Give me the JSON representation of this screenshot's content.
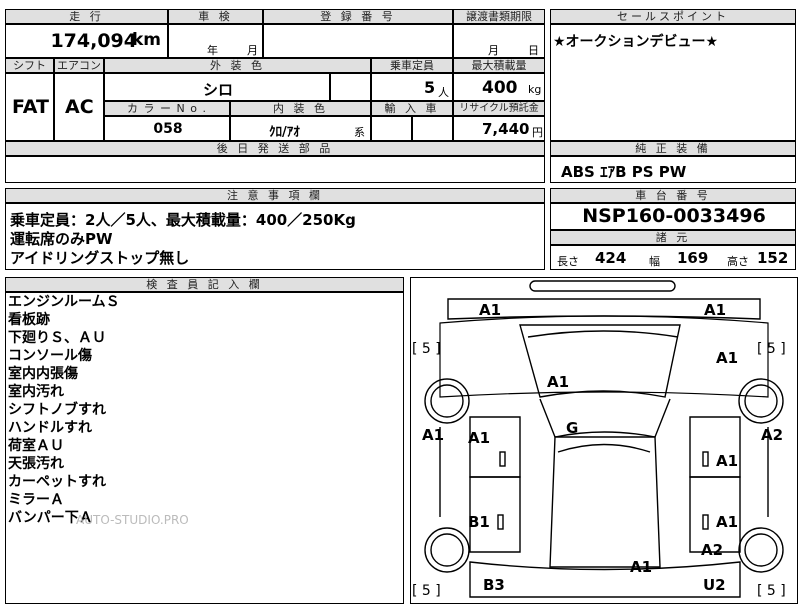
{
  "header": {
    "mileage_label": "走 行",
    "shaken_label": "車 検",
    "reg_label": "登 録 番 号",
    "transfer_label": "譲渡書類期限",
    "selling_label": "セールスポイント"
  },
  "mileage": {
    "value": "174,094",
    "unit": "km"
  },
  "shaken": {
    "year": "年",
    "month": "月"
  },
  "transfer": {
    "month": "月",
    "day": "日"
  },
  "selling_point": "★オークションデビュー★",
  "row2": {
    "shift_label": "シフト",
    "aircon_label": "エアコン",
    "exterior_label": "外 装 色",
    "capacity_label": "乗車定員",
    "maxload_label": "最大積載量",
    "shift": "FAT",
    "aircon": "AC",
    "exterior": "シロ",
    "capacity": "5",
    "capacity_unit": "人",
    "maxload": "400",
    "maxload_unit": "kg",
    "colorno_label": "カ ラ ー N o .",
    "interior_label": "内 装 色",
    "import_label": "輸 入 車",
    "recycle_label": "リサイクル預託金",
    "colorno": "058",
    "interior": "ｸﾛ/ｱｵ",
    "interior_suffix": "系",
    "recycle": "7,440",
    "recycle_unit": "円"
  },
  "later_parts_label": "後 日 発 送 部 品",
  "standard_label": "純 正 装 備",
  "standard": "ABS ｴｱB PS PW",
  "notes": {
    "label": "注 意 事 項 欄",
    "lines": [
      "乗車定員：2人／5人、最大積載量：400／250Kg",
      "運転席のみPW",
      "アイドリングストップ無し"
    ]
  },
  "chassis": {
    "label": "車 台 番 号",
    "value": "NSP160-0033496"
  },
  "dims": {
    "label": "諸 元",
    "length_label": "長さ",
    "length": "424",
    "width_label": "幅",
    "width": "169",
    "height_label": "高さ",
    "height": "152"
  },
  "inspector": {
    "label": "検 査 員 記 入 欄",
    "lines": [
      "エンジンルームＳ",
      "看板跡",
      "下廻りＳ、ＡＵ",
      "コンソール傷",
      "室内内張傷",
      "室内汚れ",
      "シフトノブすれ",
      "ハンドルすれ",
      "荷室ＡＵ",
      "天張汚れ",
      "カーペットすれ",
      "ミラーＡ",
      "バンパー下Ａ"
    ]
  },
  "watermark": "AUTO-STUDIO.PRO",
  "diagram": {
    "labels": [
      "A1",
      "A1",
      "A1",
      "A1",
      "A1",
      "G",
      "A1",
      "A2",
      "A1",
      "B1",
      "A1",
      "A2",
      "A1",
      "B3",
      "U2"
    ],
    "brackets": [
      "[ 5 ]",
      "[ 5 ]",
      "[ 5 ]",
      "[ 5 ]"
    ]
  }
}
